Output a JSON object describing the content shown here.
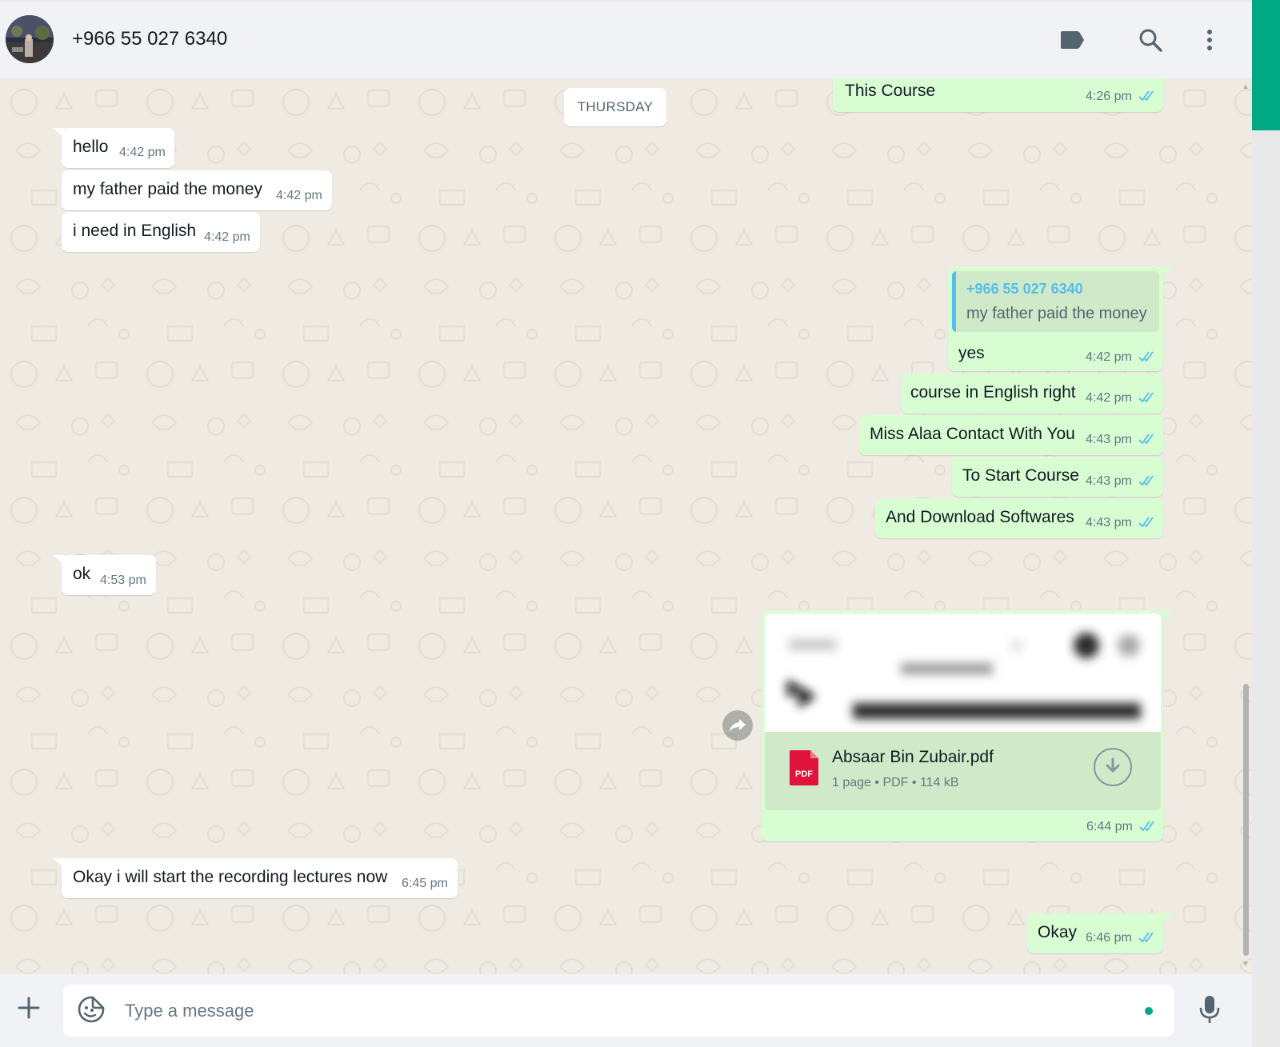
{
  "header": {
    "contact_name": "+966 55 027 6340",
    "icons": [
      "label-icon",
      "search-icon",
      "menu-icon"
    ]
  },
  "chat": {
    "date_separator": "THURSDAY",
    "messages": [
      {
        "dir": "out",
        "text": "This Course",
        "time": "4:26 pm",
        "status": "read"
      },
      {
        "dir": "in",
        "text": "hello",
        "time": "4:42 pm"
      },
      {
        "dir": "in",
        "text": "my father paid the money",
        "time": "4:42 pm"
      },
      {
        "dir": "in",
        "text": "i need in English",
        "time": "4:42 pm"
      },
      {
        "dir": "out",
        "text": "yes",
        "time": "4:42 pm",
        "status": "read",
        "quote": {
          "sender": "+966 55 027 6340",
          "text": "my father paid the money"
        }
      },
      {
        "dir": "out",
        "text": "course in English right",
        "time": "4:42 pm",
        "status": "read"
      },
      {
        "dir": "out",
        "text": "Miss Alaa Contact With You",
        "time": "4:43 pm",
        "status": "read"
      },
      {
        "dir": "out",
        "text": "To Start Course",
        "time": "4:43 pm",
        "status": "read"
      },
      {
        "dir": "out",
        "text": "And Download Softwares",
        "time": "4:43 pm",
        "status": "read"
      },
      {
        "dir": "in",
        "text": "ok",
        "time": "4:53 pm"
      },
      {
        "dir": "out",
        "type": "document",
        "time": "6:44 pm",
        "status": "read",
        "document": {
          "name": "Absaar Bin Zubair.pdf",
          "pages": "1 page",
          "format": "PDF",
          "size": "114 kB",
          "icon_label": "PDF"
        }
      },
      {
        "dir": "in",
        "text": "Okay i will start the recording lectures now",
        "time": "6:45 pm"
      },
      {
        "dir": "out",
        "text": "Okay",
        "time": "6:46 pm",
        "status": "read"
      }
    ]
  },
  "composer": {
    "placeholder": "Type a message",
    "icons": [
      "plus-icon",
      "sticker-icon",
      "mic-icon"
    ]
  },
  "colors": {
    "accent": "#00a884",
    "outgoing_bubble": "#d9fdd3",
    "incoming_bubble": "#ffffff",
    "chat_background": "#efeae2",
    "read_ticks": "#53bdeb",
    "pdf_icon": "#e0133d"
  }
}
